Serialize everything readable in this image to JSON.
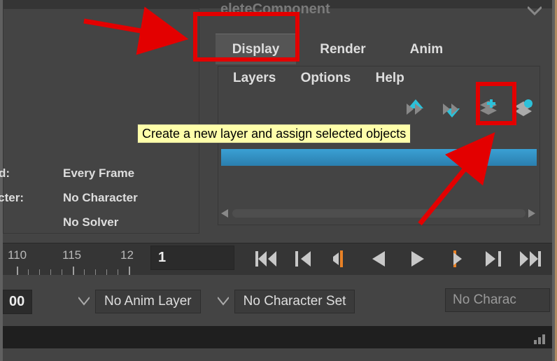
{
  "header_partial": "eleteComponent",
  "tabs": {
    "display": "Display",
    "render": "Render",
    "anim": "Anim"
  },
  "menu": {
    "layers": "Layers",
    "options": "Options",
    "help": "Help"
  },
  "tooltip": "Create a new layer and assign selected objects",
  "left": {
    "d_label": "d:",
    "d_value": "Every Frame",
    "cter_label": "cter:",
    "cter_value": "No Character",
    "solver_value": "No Solver"
  },
  "timeline": {
    "tick_110": "110",
    "tick_115": "115",
    "tick_12": "12",
    "frame": "1",
    "field00": "00"
  },
  "drops": {
    "anim_layer": "No Anim Layer",
    "char_set": "No Character Set",
    "char_cut": "No Charac"
  }
}
